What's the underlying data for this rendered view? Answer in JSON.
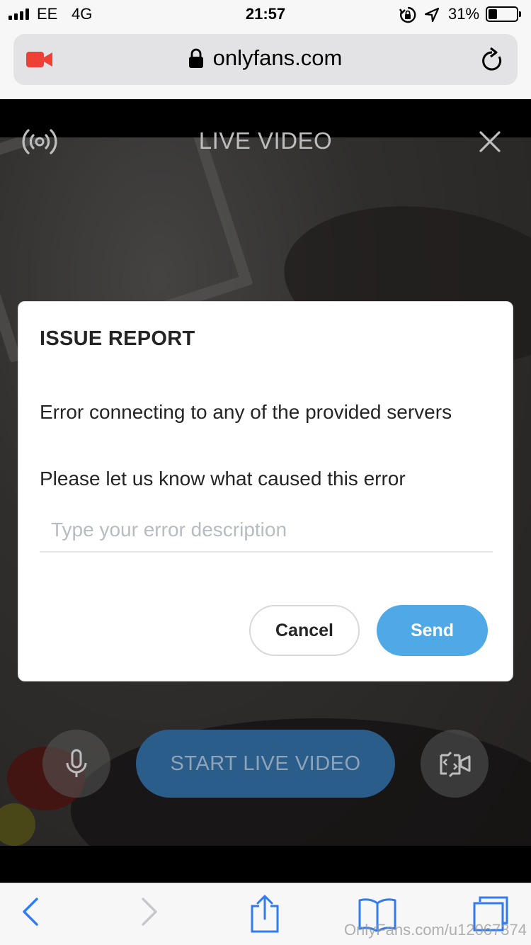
{
  "status_bar": {
    "carrier": "EE",
    "network": "4G",
    "time": "21:57",
    "battery_percent": "31%",
    "battery_level": 0.31,
    "icons": [
      "signal-icon",
      "rotation-lock-icon",
      "location-icon",
      "battery-icon"
    ]
  },
  "browser": {
    "url": "onlyfans.com",
    "icons": [
      "camera-icon",
      "lock-icon",
      "reload-icon"
    ]
  },
  "live": {
    "title": "LIVE VIDEO",
    "start_label": "START LIVE VIDEO",
    "icons": [
      "broadcast-icon",
      "close-icon",
      "microphone-icon",
      "switch-camera-icon"
    ]
  },
  "modal": {
    "title": "ISSUE REPORT",
    "error_message": "Error connecting to any of the provided servers",
    "prompt": "Please let us know what caused this error",
    "input_placeholder": "Type your error description",
    "input_value": "",
    "cancel_label": "Cancel",
    "send_label": "Send"
  },
  "toolbar": {
    "icons": [
      "back-icon",
      "forward-icon",
      "share-icon",
      "bookmarks-icon",
      "tabs-icon"
    ]
  },
  "watermark": "OnlyFans.com/u12067374",
  "colors": {
    "accent": "#4fa9e7",
    "start_button": "#2b5d8a",
    "camera_icon": "#ee4035",
    "ios_blue": "#2f7cf6"
  }
}
